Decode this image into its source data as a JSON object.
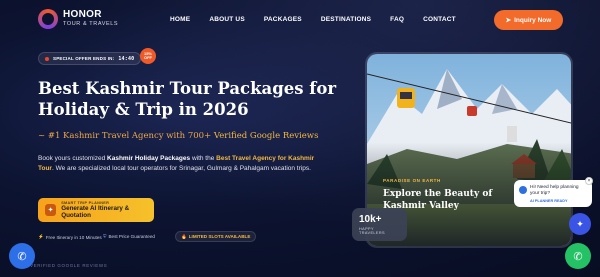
{
  "brand": {
    "name": "HONOR",
    "sub": "TOUR & TRAVELS"
  },
  "nav": {
    "items": [
      "HOME",
      "ABOUT US",
      "PACKAGES",
      "DESTINATIONS",
      "FAQ",
      "CONTACT"
    ],
    "cta": "Inquiry Now"
  },
  "offer": {
    "label": "SPECIAL OFFER ENDS IN:",
    "timer": "14:40",
    "badge": "15% OFF"
  },
  "hero": {
    "title": "Best Kashmir Tour Packages for Holiday & Trip in 2026",
    "tagline_prefix": "~ #1 Kashmir Travel Agency with 700+",
    "tagline_highlight": "Verified Google Reviews",
    "desc_1": "Book yours customized",
    "desc_b1": "Kashmir Holiday Packages",
    "desc_2": "with the",
    "desc_b2": "Best Travel Agency for Kashmir Tour",
    "desc_3": ". We are specialized local tour operators for Srinagar, Gulmarg & Pahalgam vacation trips.",
    "cta_small": "SMART TRIP PLANNER",
    "cta_main": "Generate AI Itinerary & Quotation"
  },
  "features": [
    "Free Itinerary in 10 Minutes",
    "Best Price Guaranteed"
  ],
  "slots": "LIMITED SLOTS AVAILABLE",
  "verified": "VERIFIED GOOGLE REVIEWS",
  "card": {
    "kicker": "PARADISE ON EARTH",
    "title": "Explore the Beauty of Kashmir Valley"
  },
  "stat": {
    "number": "10k+",
    "label": "HAPPY TRAVELERS"
  },
  "chat": {
    "message": "Hi! Need help planning your trip?",
    "status": "AI PLANNER READY"
  },
  "colors": {
    "accent": "#f36b2b",
    "gold": "#f4b942",
    "background": "#0b1026",
    "whatsapp": "#25c165"
  },
  "icons": {
    "call": "phone-icon",
    "whatsapp": "whatsapp-icon",
    "ai": "sparkle-icon"
  }
}
